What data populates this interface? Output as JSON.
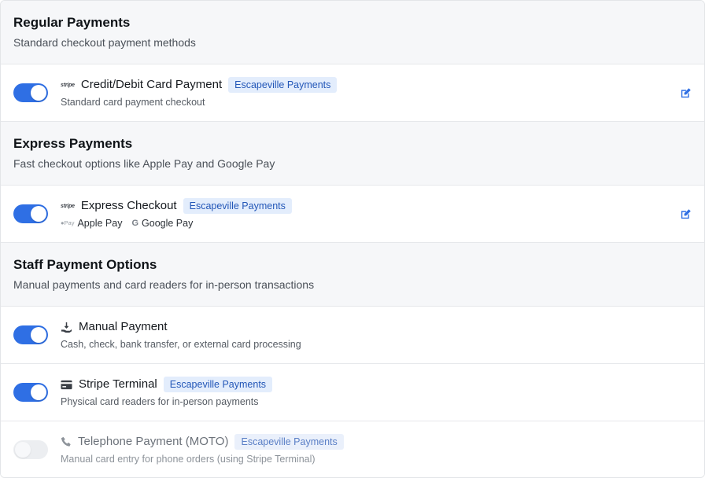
{
  "sections": [
    {
      "title": "Regular Payments",
      "subtitle": "Standard checkout payment methods"
    },
    {
      "title": "Express Payments",
      "subtitle": "Fast checkout options like Apple Pay and Google Pay"
    },
    {
      "title": "Staff Payment Options",
      "subtitle": "Manual payments and card readers for in-person transactions"
    }
  ],
  "rows": {
    "card": {
      "logo": "stripe",
      "title": "Credit/Debit Card Payment",
      "badge": "Escapeville Payments",
      "subtitle": "Standard card payment checkout",
      "enabled": true
    },
    "express": {
      "logo": "stripe",
      "title": "Express Checkout",
      "badge": "Escapeville Payments",
      "methods": [
        {
          "mark": "Pay",
          "label": "Apple Pay"
        },
        {
          "mark": "G",
          "label": "Google Pay"
        }
      ],
      "enabled": true
    },
    "manual": {
      "icon": "hand-money-icon",
      "title": "Manual Payment",
      "subtitle": "Cash, check, bank transfer, or external card processing",
      "enabled": true
    },
    "terminal": {
      "icon": "credit-card-icon",
      "title": "Stripe Terminal",
      "badge": "Escapeville Payments",
      "subtitle": "Physical card readers for in-person payments",
      "enabled": true
    },
    "moto": {
      "icon": "phone-icon",
      "title": "Telephone Payment (MOTO)",
      "badge": "Escapeville Payments",
      "subtitle": "Manual card entry for phone orders (using Stripe Terminal)",
      "enabled": false
    }
  },
  "colors": {
    "accent": "#2f6fe4",
    "badge_bg": "#e3edfc",
    "badge_text": "#2357b8",
    "section_bg": "#f6f7f9"
  }
}
